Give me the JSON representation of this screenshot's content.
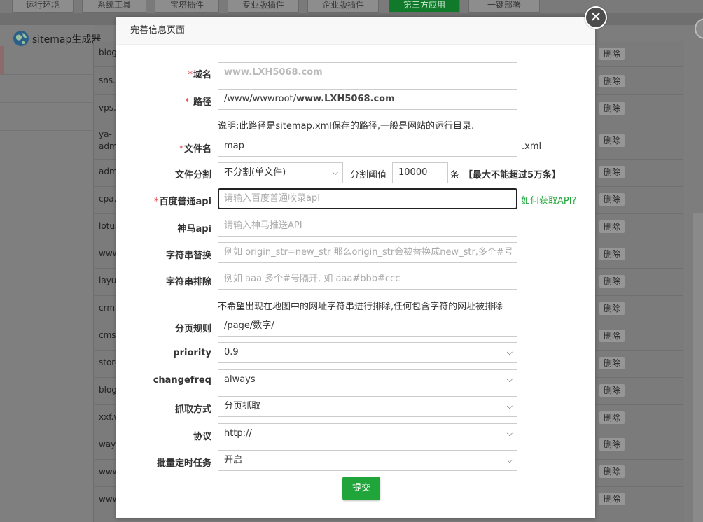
{
  "bg": {
    "tabs": [
      "运行环境",
      "系统工具",
      "宝塔插件",
      "专业版插件",
      "企业版插件",
      "第三方应用",
      "一键部署"
    ],
    "app_title": "sitemap生成器",
    "rows": [
      "blog",
      "sns.",
      "vps.",
      "ya-\nadm",
      "adm",
      "cpa.",
      "lotus",
      "www",
      "layu",
      "crm.",
      "cms.",
      "store",
      "blog",
      "xxf.w",
      "wayt",
      "www",
      "www"
    ],
    "delete_label": "删除"
  },
  "modal": {
    "title": "完善信息页面",
    "close_glyph": "✕",
    "required_mark": "*",
    "domain": {
      "label": "域名",
      "placeholder": "www.LXH5068.com"
    },
    "path": {
      "label": "路径",
      "prefix": "/www/wwwroot/",
      "value": "www.LXH5068.com",
      "note": "说明:此路径是sitemap.xml保存的路径,一般是网站的运行目录."
    },
    "filename": {
      "label": "文件名",
      "value": "map",
      "suffix": ".xml"
    },
    "split": {
      "label": "文件分割",
      "selected": "不分割(单文件)",
      "threshold_label": "分割阈值",
      "threshold_value": "10000",
      "unit": "条",
      "note": "【最大不能超过5万条】"
    },
    "baidu_api": {
      "label": "百度普通api",
      "placeholder": "请输入百度普通收录api",
      "help_link": "如何获取API?"
    },
    "shenma_api": {
      "label": "神马api",
      "placeholder": "请输入神马推送API"
    },
    "str_replace": {
      "label": "字符串替换",
      "placeholder": "例如 origin_str=new_str 那么origin_str会被替换成new_str,多个#号"
    },
    "str_exclude": {
      "label": "字符串排除",
      "placeholder": "例如 aaa 多个#号隔开, 如 aaa#bbb#ccc",
      "note": "不希望出现在地图中的网址字符串进行排除,任何包含字符的网址被排除"
    },
    "paging_rule": {
      "label": "分页规则",
      "value": "/page/数字/"
    },
    "priority": {
      "label": "priority",
      "selected": "0.9"
    },
    "changefreq": {
      "label": "changefreq",
      "selected": "always"
    },
    "crawl_mode": {
      "label": "抓取方式",
      "selected": "分页抓取"
    },
    "protocol": {
      "label": "协议",
      "selected": "http://"
    },
    "batch_task": {
      "label": "批量定时任务",
      "selected": "开启"
    },
    "submit_label": "提交"
  },
  "colors": {
    "accent": "#20a53a",
    "required": "#e4393c"
  }
}
